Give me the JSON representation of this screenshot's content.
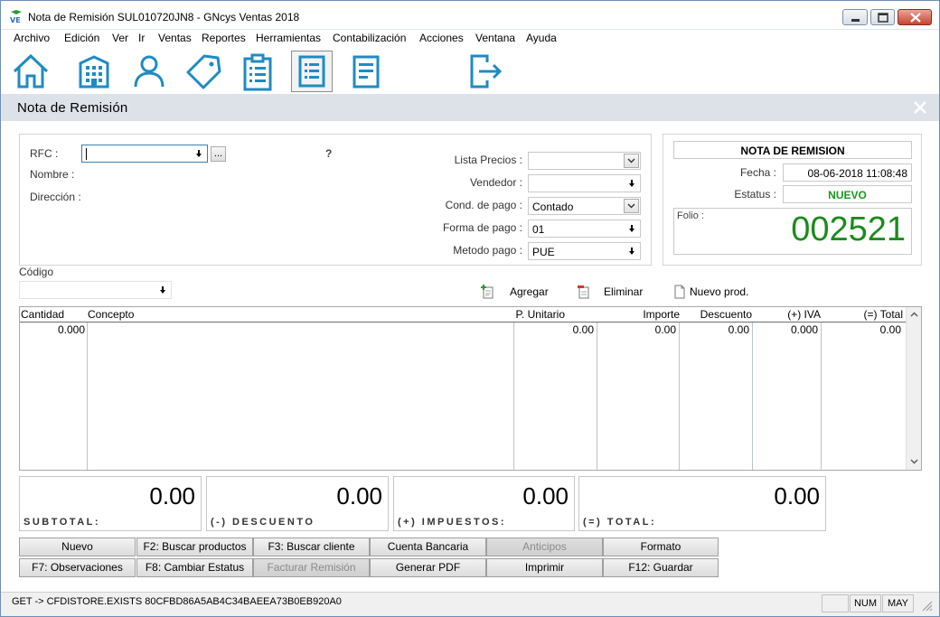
{
  "window": {
    "title": "Nota de Remisión SUL010720JN8 - GNcys Ventas 2018"
  },
  "menu": [
    "Archivo",
    "Edición",
    "Ver",
    "Ir",
    "Ventas",
    "Reportes",
    "Herramientas",
    "Contabilización",
    "Acciones",
    "Ventana",
    "Ayuda"
  ],
  "toolbar": {
    "icons": [
      "home-icon",
      "building-icon",
      "user-icon",
      "tag-icon",
      "clipboard-icon",
      "list-document-icon",
      "document-icon",
      "exit-icon"
    ],
    "active": "list-document-icon"
  },
  "page": {
    "title": "Nota de Remisión"
  },
  "client": {
    "rfc_label": "RFC :",
    "rfc_value": "",
    "rfc_lookup": "...",
    "help": "?",
    "nombre_label": "Nombre :",
    "direccion_label": "Dirección :"
  },
  "terms": {
    "lista_precios_label": "Lista Precios :",
    "lista_precios_value": "",
    "vendedor_label": "Vendedor :",
    "vendedor_value": "",
    "cond_pago_label": "Cond. de pago :",
    "cond_pago_value": "Contado",
    "forma_pago_label": "Forma de pago :",
    "forma_pago_value": "01",
    "metodo_pago_label": "Metodo pago :",
    "metodo_pago_value": "PUE"
  },
  "doc": {
    "header": "NOTA DE REMISION",
    "fecha_label": "Fecha :",
    "fecha_value": "08-06-2018 11:08:48",
    "estatus_label": "Estatus :",
    "estatus_value": "NUEVO",
    "folio_label": "Folio :",
    "folio_value": "002521",
    "status_color": "#1a9a1a",
    "folio_color": "#1d8a1d"
  },
  "codigo": {
    "label": "Código",
    "value": ""
  },
  "item_actions": {
    "agregar": "Agregar",
    "eliminar": "Eliminar",
    "nuevo_prod": "Nuevo prod."
  },
  "grid": {
    "columns": [
      "Cantidad",
      "Concepto",
      "P. Unitario",
      "Importe",
      "Descuento",
      "(+) IVA",
      "(=) Total"
    ],
    "row": {
      "cantidad": "0.000",
      "concepto": "",
      "p_unitario": "0.00",
      "importe": "0.00",
      "descuento": "0.00",
      "iva": "0.000",
      "total": "0.00"
    }
  },
  "totals": {
    "subtotal_value": "0.00",
    "subtotal_label": "SUBTOTAL:",
    "descuento_value": "0.00",
    "descuento_label": "(-) DESCUENTO",
    "impuestos_value": "0.00",
    "impuestos_label": "(+) IMPUESTOS:",
    "total_value": "0.00",
    "total_label": "(=) TOTAL:"
  },
  "buttons": {
    "nuevo": "Nuevo",
    "buscar_productos": "F2: Buscar productos",
    "buscar_cliente": "F3: Buscar cliente",
    "cuenta_bancaria": "Cuenta Bancaria",
    "anticipos": "Anticipos",
    "formato": "Formato",
    "observaciones": "F7: Observaciones",
    "cambiar_estatus": "F8: Cambiar Estatus",
    "facturar_remision": "Facturar Remisión",
    "generar_pdf": "Generar PDF",
    "imprimir": "Imprimir",
    "guardar": "F12:  Guardar"
  },
  "status": {
    "message": "GET -> CFDISTORE.EXISTS 80CFBD86A5AB4C34BAEEA73B0EB920A0",
    "num": "NUM",
    "may": "MAY"
  },
  "colors": {
    "icon_blue": "#1e8bc3",
    "header_bg": "#dde2e9"
  }
}
